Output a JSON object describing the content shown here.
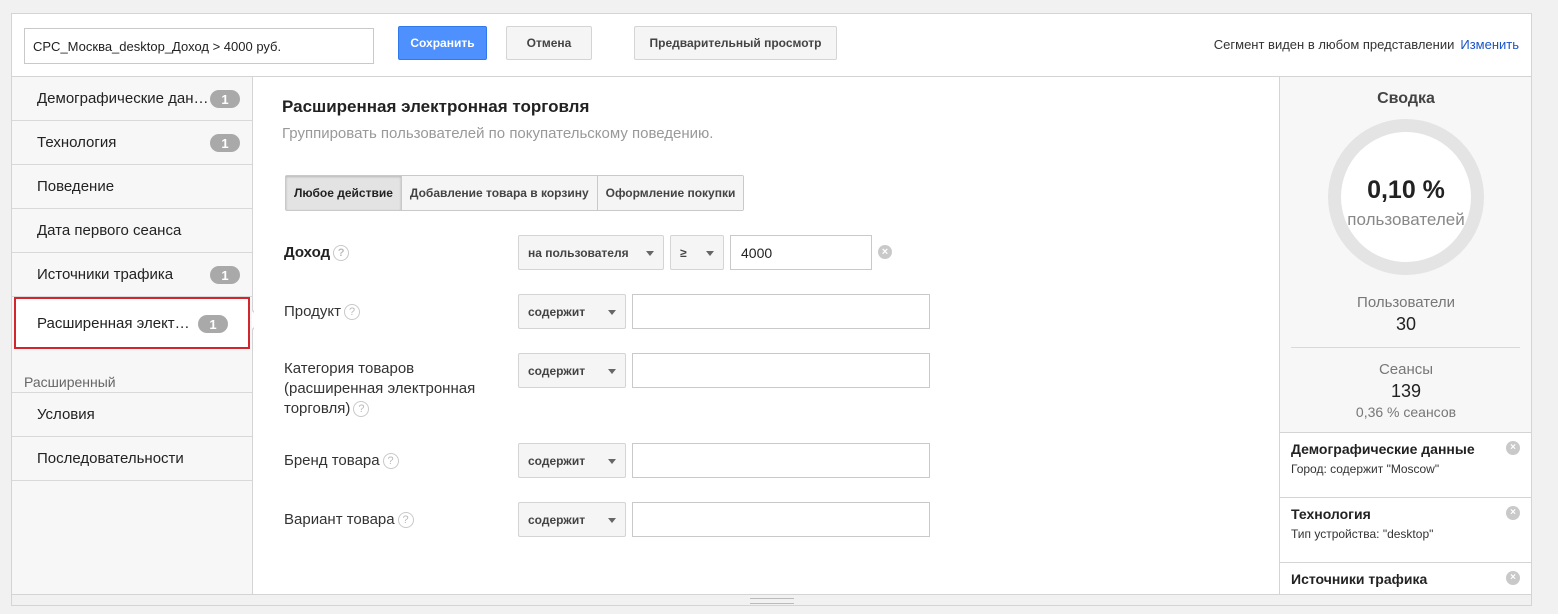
{
  "toolbar": {
    "segment_name": "CPC_Москва_desktop_Доход > 4000 руб.",
    "save_label": "Сохранить",
    "cancel_label": "Отмена",
    "preview_label": "Предварительный просмотр",
    "visibility_text": "Сегмент виден в любом представлении",
    "change_label": "Изменить"
  },
  "sidebar": {
    "items": [
      {
        "label": "Демографические данные",
        "badge": "1"
      },
      {
        "label": "Технология",
        "badge": "1"
      },
      {
        "label": "Поведение",
        "badge": ""
      },
      {
        "label": "Дата первого сеанса",
        "badge": ""
      },
      {
        "label": "Источники трафика",
        "badge": "1"
      },
      {
        "label": "Расширенная электронная торговля",
        "badge": "1"
      }
    ],
    "advanced_heading": "Расширенный",
    "advanced_items": [
      {
        "label": "Условия"
      },
      {
        "label": "Последовательности"
      }
    ]
  },
  "main": {
    "title": "Расширенная электронная торговля",
    "subtitle": "Группировать пользователей по покупательскому поведению.",
    "tabs": [
      {
        "label": "Любое действие",
        "active": true
      },
      {
        "label": "Добавление товара в корзину",
        "active": false
      },
      {
        "label": "Оформление покупки",
        "active": false
      }
    ],
    "filters": {
      "revenue": {
        "label": "Доход",
        "scope": "на пользователя",
        "operator": "≥",
        "value": "4000"
      },
      "product": {
        "label": "Продукт",
        "operator": "содержит",
        "value": ""
      },
      "category": {
        "label": "Категория товаров (расширенная электронная торговля)",
        "operator": "содержит",
        "value": ""
      },
      "brand": {
        "label": "Бренд товара",
        "operator": "содержит",
        "value": ""
      },
      "variant": {
        "label": "Вариант товара",
        "operator": "содержит",
        "value": ""
      }
    },
    "help_glyph": "?"
  },
  "summary": {
    "title": "Сводка",
    "percent": "0,10 %",
    "percent_label": "пользователей",
    "users_label": "Пользователи",
    "users_value": "30",
    "sessions_label": "Сеансы",
    "sessions_value": "139",
    "sessions_share": "0,36 % сеансов",
    "conditions": [
      {
        "title": "Демографические данные",
        "desc": "Город: содержит \"Moscow\""
      },
      {
        "title": "Технология",
        "desc": "Тип устройства: \"desktop\""
      },
      {
        "title": "Источники трафика",
        "desc": ""
      }
    ],
    "remove_glyph": "×"
  },
  "colors": {
    "primary": "#4d90fe",
    "highlight": "#d2262c",
    "link": "#1a55c5"
  }
}
